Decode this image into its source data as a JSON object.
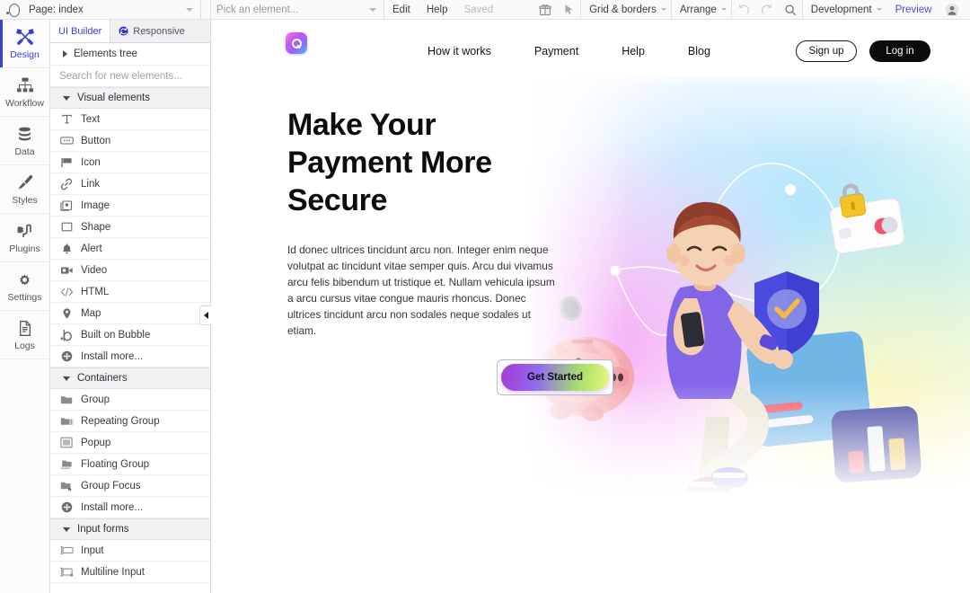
{
  "topbar": {
    "logo_icon": "bubble-logo-icon",
    "page_select": {
      "label": "Page: index",
      "caret_icon": "chevron-down-icon"
    },
    "element_picker": {
      "placeholder": "Pick an element...",
      "caret_icon": "chevron-down-icon"
    },
    "edit_label": "Edit",
    "help_label": "Help",
    "saved_label": "Saved",
    "gift_icon": "gift-icon",
    "cursor_icon": "cursor-arrow-icon",
    "grid_borders": {
      "label": "Grid & borders",
      "caret_icon": "chevron-down-icon"
    },
    "arrange": {
      "label": "Arrange",
      "caret_icon": "chevron-down-icon"
    },
    "undo_icon": "undo-arrow-icon",
    "redo_icon": "redo-arrow-icon",
    "search_icon": "search-icon",
    "version": {
      "label": "Development",
      "caret_icon": "chevron-down-icon"
    },
    "preview_label": "Preview",
    "avatar_icon": "user-avatar-icon"
  },
  "rail": {
    "items": [
      {
        "label": "Design",
        "icon": "design-crossed-tools-icon",
        "active": true
      },
      {
        "label": "Workflow",
        "icon": "workflow-hierarchy-icon",
        "active": false
      },
      {
        "label": "Data",
        "icon": "database-icon",
        "active": false
      },
      {
        "label": "Styles",
        "icon": "paintbrush-icon",
        "active": false
      },
      {
        "label": "Plugins",
        "icon": "plug-icon",
        "active": false
      },
      {
        "label": "Settings",
        "icon": "gear-icon",
        "active": false
      },
      {
        "label": "Logs",
        "icon": "document-lines-icon",
        "active": false
      }
    ]
  },
  "panel": {
    "tabs": [
      {
        "label": "UI Builder",
        "icon": null,
        "active": true
      },
      {
        "label": "Responsive",
        "icon": "responsive-refresh-icon",
        "active": false
      }
    ],
    "elements_tree": {
      "label": "Elements tree",
      "caret_icon": "triangle-right-icon",
      "expanded": false
    },
    "search": {
      "placeholder": "Search for new elements...",
      "value": ""
    },
    "sections": [
      {
        "title": "Visual elements",
        "caret_icon": "triangle-down-icon",
        "expanded": true,
        "items": [
          {
            "label": "Text",
            "icon": "text-t-icon"
          },
          {
            "label": "Button",
            "icon": "button-icon"
          },
          {
            "label": "Icon",
            "icon": "flag-icon"
          },
          {
            "label": "Link",
            "icon": "link-chain-icon"
          },
          {
            "label": "Image",
            "icon": "image-icon"
          },
          {
            "label": "Shape",
            "icon": "square-shape-icon"
          },
          {
            "label": "Alert",
            "icon": "bell-alert-icon"
          },
          {
            "label": "Video",
            "icon": "video-camera-icon"
          },
          {
            "label": "HTML",
            "icon": "code-brackets-icon"
          },
          {
            "label": "Map",
            "icon": "map-pin-icon"
          },
          {
            "label": "Built on Bubble",
            "icon": "bubble-logo-icon"
          },
          {
            "label": "Install more...",
            "icon": "plus-circle-icon"
          }
        ]
      },
      {
        "title": "Containers",
        "caret_icon": "triangle-down-icon",
        "expanded": true,
        "items": [
          {
            "label": "Group",
            "icon": "folder-icon"
          },
          {
            "label": "Repeating Group",
            "icon": "folder-repeat-icon"
          },
          {
            "label": "Popup",
            "icon": "popup-window-icon"
          },
          {
            "label": "Floating Group",
            "icon": "floating-folder-icon"
          },
          {
            "label": "Group Focus",
            "icon": "group-focus-icon"
          },
          {
            "label": "Install more...",
            "icon": "plus-circle-icon"
          }
        ]
      },
      {
        "title": "Input forms",
        "caret_icon": "triangle-down-icon",
        "expanded": true,
        "items": [
          {
            "label": "Input",
            "icon": "input-field-icon"
          },
          {
            "label": "Multiline Input",
            "icon": "multiline-input-icon"
          }
        ]
      }
    ],
    "collapse_handle_icon": "triangle-left-icon"
  },
  "canvas": {
    "site": {
      "logo_icon": "app-logo-q-icon",
      "nav_links": [
        {
          "label": "How it works"
        },
        {
          "label": "Payment"
        },
        {
          "label": "Help"
        },
        {
          "label": "Blog"
        }
      ],
      "sign_up_label": "Sign up",
      "log_in_label": "Log in",
      "hero": {
        "title": "Make Your\nPayment More\nSecure",
        "paragraph": "Id donec ultrices tincidunt arcu non. Integer enim neque volutpat ac tincidunt vitae semper quis. Arcu dui vivamus arcu felis bibendum ut tristique et. Nullam vehicula ipsum a arcu cursus vitae congue mauris rhoncus. Donec ultrices tincidunt arcu non sodales neque sodales ut etiam.",
        "cta_label": "Get Started",
        "illustration": {
          "name": "payment-security-3d-illustration",
          "objects": [
            "person-with-phone",
            "piggy-bank",
            "coin",
            "credit-card-with-lock",
            "shield-with-checkmark",
            "blue-card",
            "bar-chart-card"
          ]
        }
      }
    }
  },
  "colors": {
    "accent": "#3a41d6",
    "preview_link": "#4a4ae0",
    "panel_bg": "#ffffff",
    "rail_bg": "#fbfbfb",
    "section_header_bg": "#f2f2f4",
    "cta_gradient_start": "#a43fd8",
    "cta_gradient_end": "#e9f77e",
    "login_bg": "#0b0b0d"
  }
}
